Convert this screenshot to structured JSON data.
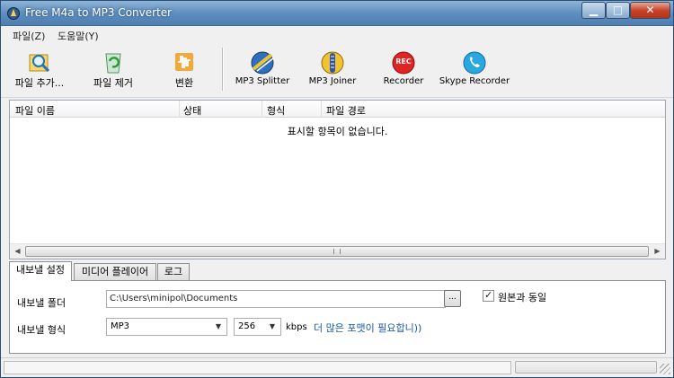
{
  "window": {
    "title": "Free M4a to MP3 Converter"
  },
  "menu": [
    "파일(Z)",
    "도움말(Y)"
  ],
  "toolbar": {
    "add_file": "파일 추가...",
    "remove_file": "파일 제거",
    "convert": "변환",
    "mp3_splitter": "MP3 Splitter",
    "mp3_joiner": "MP3 Joiner",
    "recorder": "Recorder",
    "skype_recorder": "Skype Recorder",
    "rec_badge": "REC"
  },
  "file_list": {
    "columns": [
      "파일 이름",
      "상태",
      "형식",
      "파일 경로"
    ],
    "empty_message": "표시할 항목이 없습니다."
  },
  "tabs": [
    "내보낼 설정",
    "미디어 플레이어",
    "로그"
  ],
  "export": {
    "folder_label": "내보낼 폴더",
    "folder_value": "C:\\Users\\minipol\\Documents",
    "browse_label": "...",
    "same_as_source_label": "원본과 동일",
    "same_as_source_checked": true,
    "format_label": "내보낼 형식",
    "format_value": "MP3",
    "bitrate_value": "256",
    "bitrate_unit": "kbps",
    "more_formats_link": "더 많은 포맷이 필요합니))"
  },
  "colors": {
    "accent": "#1a5aa8",
    "title_bar": "#5f8fbf",
    "close_button": "#c8452b"
  }
}
